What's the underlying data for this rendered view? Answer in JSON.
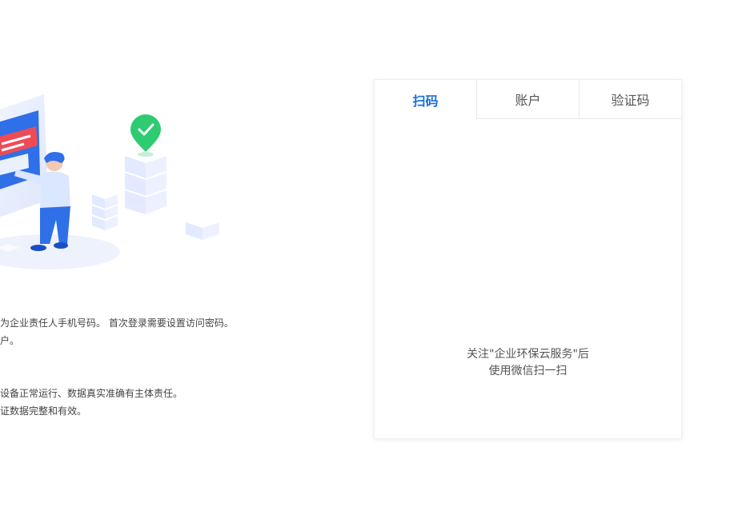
{
  "info": {
    "line1": "为企业责任人手机号码。 首次登录需要设置访问密码。",
    "line2": "户。",
    "line3": "设备正常运行、数据真实准确有主体责任。",
    "line4": "证数据完整和有效。"
  },
  "login": {
    "tabs": [
      {
        "label": "扫码"
      },
      {
        "label": "账户"
      },
      {
        "label": "验证码"
      }
    ],
    "active_tab": "扫码",
    "qr_caption_line1": "关注\"企业环保云服务\"后",
    "qr_caption_line2": "使用微信扫一扫"
  },
  "colors": {
    "accent": "#1a6fd6",
    "check_green": "#2ecc71",
    "illustration_blue": "#2f6fe8"
  }
}
